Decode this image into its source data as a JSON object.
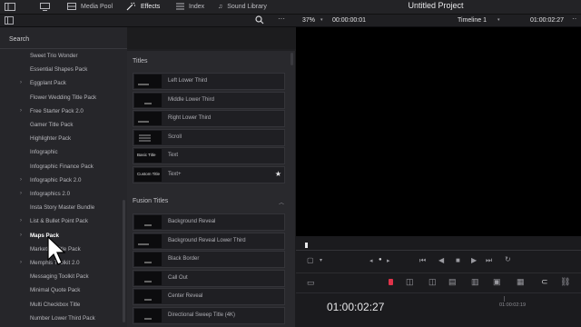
{
  "topbar": {
    "media_pool": "Media Pool",
    "effects": "Effects",
    "index": "Index",
    "sound_library": "Sound Library",
    "project_title": "Untitled Project"
  },
  "viewerbar": {
    "zoom": "37%",
    "timecode_left": "00:00:00:01",
    "timeline": "Timeline 1",
    "timecode_right": "01:00:02:27"
  },
  "search": {
    "label": "Search"
  },
  "tree": [
    {
      "label": "Sweet Trio Wonder",
      "arrow": false
    },
    {
      "label": "Essential Shapes Pack",
      "arrow": false
    },
    {
      "label": "Eggplant Pack",
      "arrow": true
    },
    {
      "label": "Flower Wedding Title Pack",
      "arrow": false
    },
    {
      "label": "Free Starter Pack 2.0",
      "arrow": true
    },
    {
      "label": "Gamer Title Pack",
      "arrow": false
    },
    {
      "label": "Highlighter Pack",
      "arrow": false
    },
    {
      "label": "Infographic",
      "arrow": false
    },
    {
      "label": "Infographic Finance Pack",
      "arrow": false
    },
    {
      "label": "Infographic Pack 2.0",
      "arrow": true
    },
    {
      "label": "Infographics 2.0",
      "arrow": true
    },
    {
      "label": "Insta Story Master Bundle",
      "arrow": false
    },
    {
      "label": "List & Bullet Point Pack",
      "arrow": true
    },
    {
      "label": "Maps Pack",
      "arrow": true,
      "active": true
    },
    {
      "label": "Marketing Title Pack",
      "arrow": false
    },
    {
      "label": "Memphis Toolkit 2.0",
      "arrow": true
    },
    {
      "label": "Messaging Toolkit Pack",
      "arrow": false
    },
    {
      "label": "Minimal Quote Pack",
      "arrow": false
    },
    {
      "label": "Multi Checkbox Title",
      "arrow": false
    },
    {
      "label": "Number Lower Third Pack",
      "arrow": false
    }
  ],
  "titles_section": {
    "heading": "Titles",
    "items": [
      {
        "name": "Left Lower Third",
        "thumb": "line"
      },
      {
        "name": "Middle Lower Third",
        "thumb": "dot"
      },
      {
        "name": "Right Lower Third",
        "thumb": "line"
      },
      {
        "name": "Scroll",
        "thumb": "lines"
      },
      {
        "name": "Text",
        "thumb_text": "Basic Title"
      },
      {
        "name": "Text+",
        "thumb_text": "Custom Title",
        "star": true
      }
    ]
  },
  "fusion_section": {
    "heading": "Fusion Titles",
    "items": [
      {
        "name": "Background Reveal"
      },
      {
        "name": "Background Reveal Lower Third"
      },
      {
        "name": "Black Border"
      },
      {
        "name": "Call Out"
      },
      {
        "name": "Center Reveal"
      },
      {
        "name": "Directional Sweep Title (4K)"
      }
    ]
  },
  "viewer_controls": {
    "timecode_big": "01:00:02:27",
    "ruler_time": "01:00:02:19"
  }
}
